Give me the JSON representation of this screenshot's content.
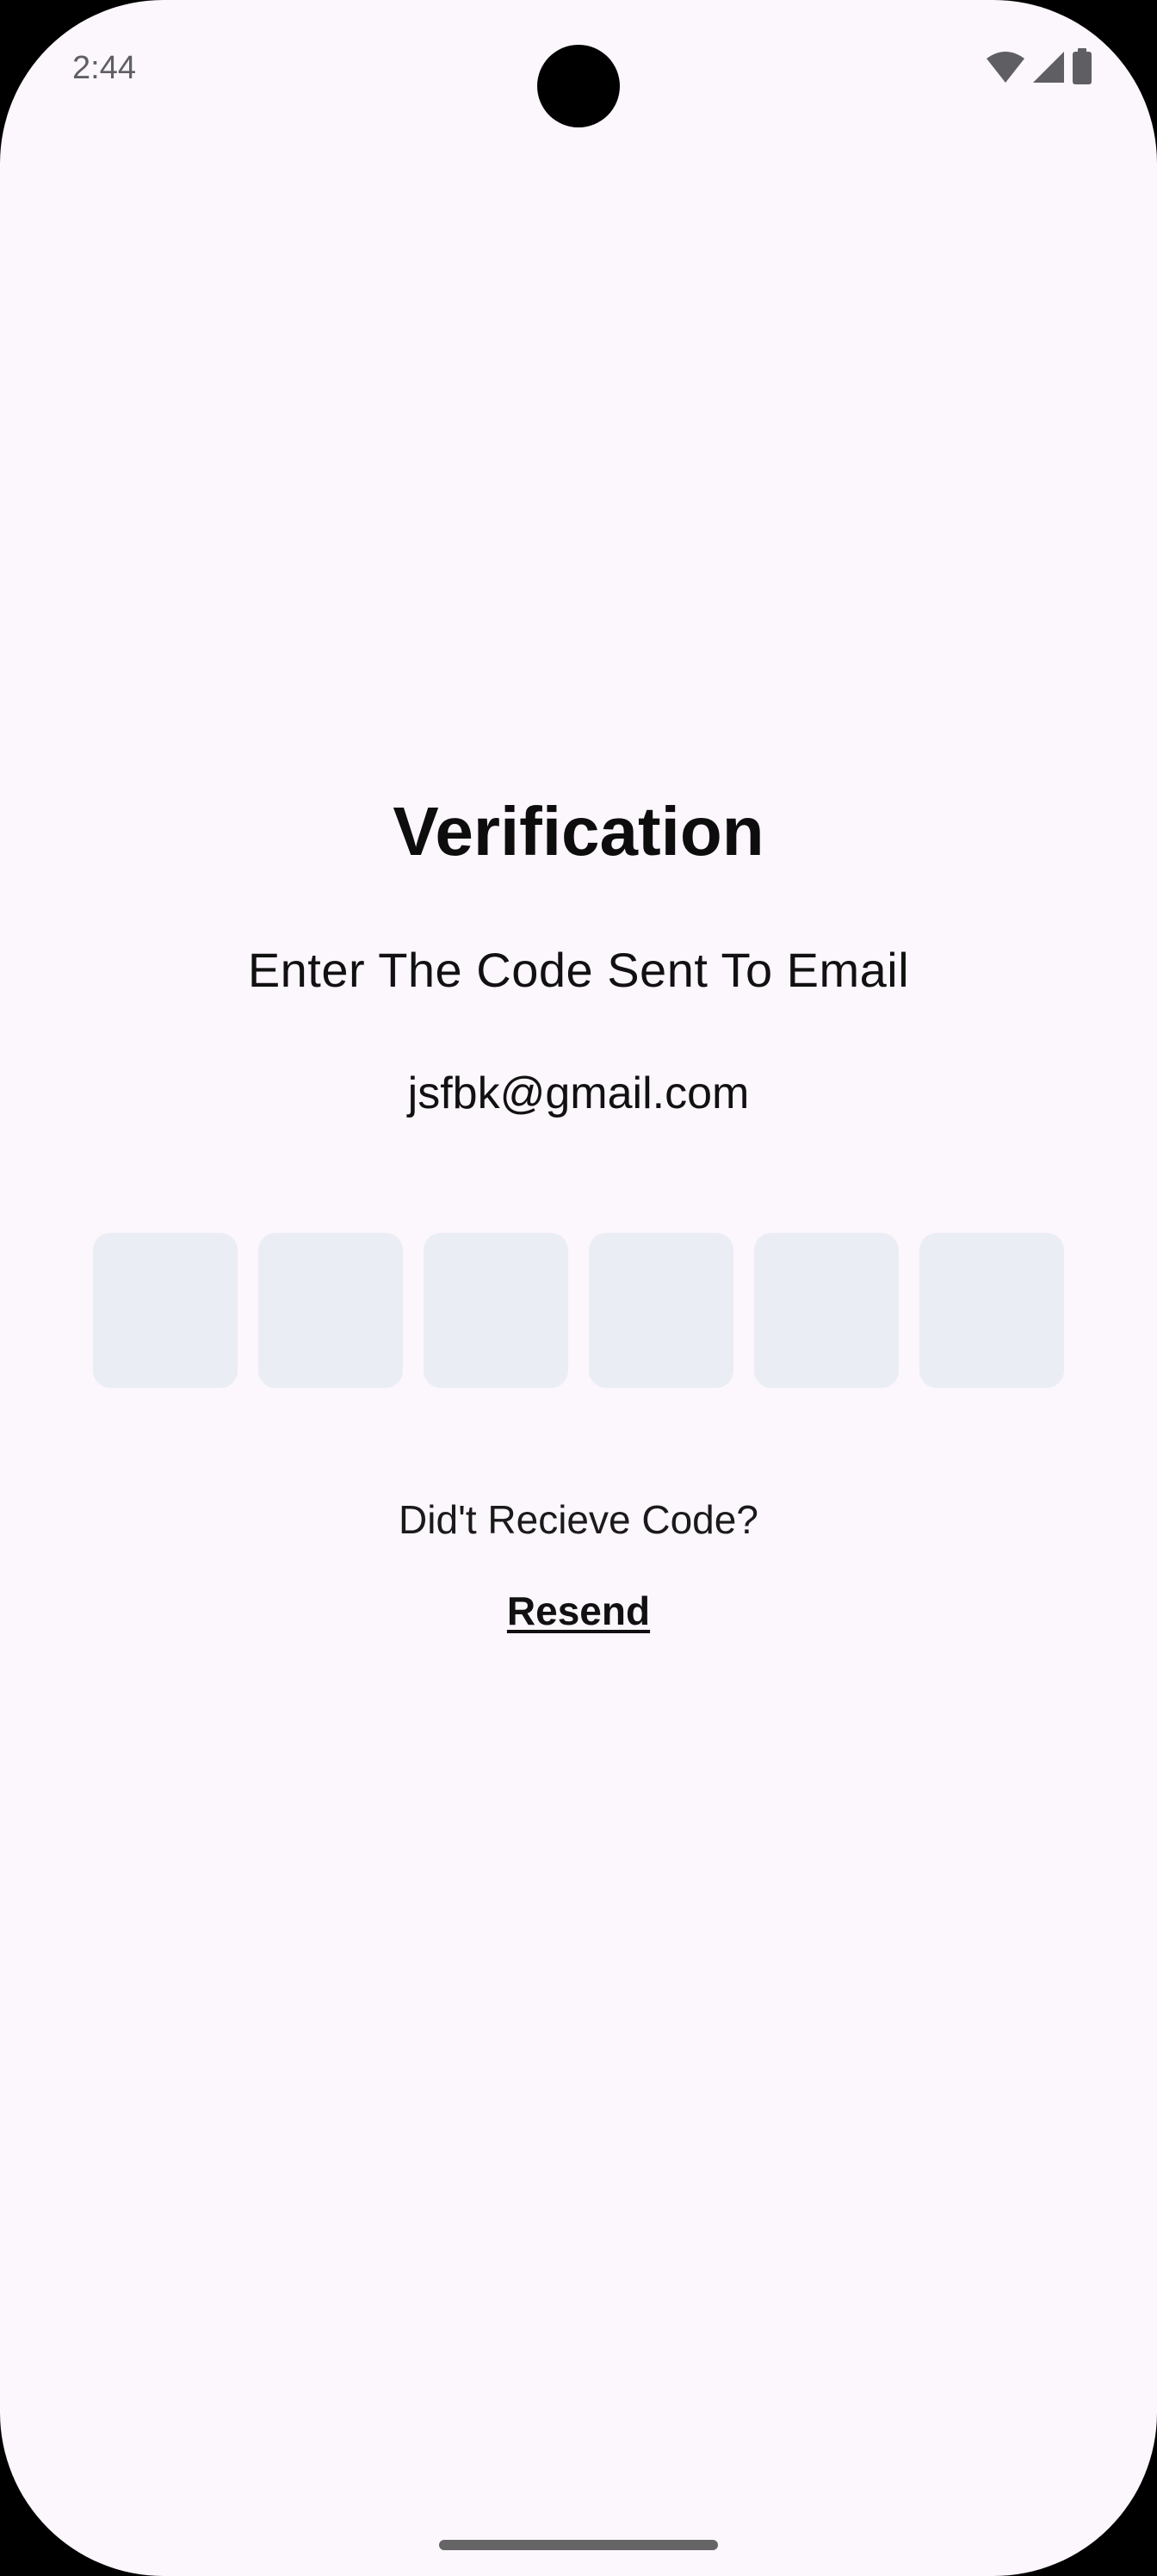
{
  "status_bar": {
    "time": "2:44",
    "icons": [
      "wifi-icon",
      "cellular-signal-icon",
      "battery-icon"
    ]
  },
  "verification": {
    "title": "Verification",
    "subtitle": "Enter The Code Sent To Email",
    "email": "jsfbk@gmail.com",
    "code_digits": [
      "",
      "",
      "",
      "",
      "",
      ""
    ],
    "didnt_receive": "Did't Recieve Code?",
    "resend_label": "Resend"
  },
  "colors": {
    "background": "#fcf6fd",
    "otp_box": "#ebedf4",
    "text": "#111111"
  }
}
